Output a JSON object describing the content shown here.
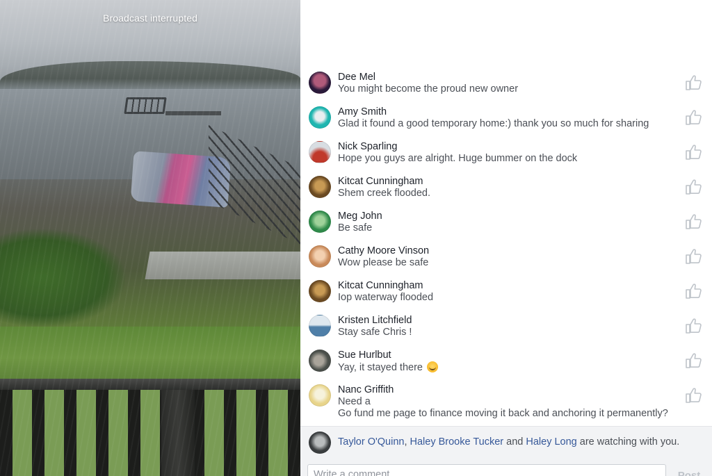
{
  "video": {
    "status_text": "Broadcast interrupted"
  },
  "comments": [
    {
      "author": "Dee Mel",
      "text": "You might become the proud new owner",
      "avatar_colors": [
        "#2a1a3a",
        "#b05a7a"
      ]
    },
    {
      "author": "Amy Smith",
      "text": "Glad it found a good temporary home:) thank you so much for sharing",
      "avatar_colors": [
        "#1fb6b0",
        "#e8eef0"
      ]
    },
    {
      "author": "Nick Sparling",
      "text": "Hope you guys are alright. Huge bummer on the dock",
      "avatar_colors": [
        "#d8dde2",
        "#c0392b"
      ]
    },
    {
      "author": "Kitcat Cunningham",
      "text": "Shem creek flooded.",
      "avatar_colors": [
        "#6b4a22",
        "#c89a54"
      ]
    },
    {
      "author": "Meg John",
      "text": "Be safe",
      "avatar_colors": [
        "#2f8a4a",
        "#9fd29a"
      ]
    },
    {
      "author": "Cathy Moore Vinson",
      "text": "Wow please be safe",
      "avatar_colors": [
        "#c98a5a",
        "#f3d0b0"
      ]
    },
    {
      "author": "Kitcat Cunningham",
      "text": "Iop waterway flooded",
      "avatar_colors": [
        "#6b4a22",
        "#c89a54"
      ]
    },
    {
      "author": "Kristen Litchfield",
      "text": "Stay safe Chris !",
      "avatar_colors": [
        "#4f7fa8",
        "#dfe8ef"
      ]
    },
    {
      "author": "Sue Hurlbut",
      "text": "Yay, it stayed there",
      "emoji": "grinning-face",
      "avatar_colors": [
        "#4a4f4a",
        "#a9a49a"
      ]
    },
    {
      "author": "Nanc Griffith",
      "text_lines": [
        "Need a",
        "Go fund me page to finance moving it back and anchoring it permanently?"
      ],
      "avatar_colors": [
        "#e8d48a",
        "#f6f2dc"
      ]
    }
  ],
  "watching": {
    "viewer_1": "Taylor O'Quinn",
    "separator_1": ",",
    "viewer_2": "Haley Brooke Tucker",
    "conjunction": "and",
    "viewer_3": "Haley Long",
    "suffix": "are watching with you.",
    "avatar_colors": [
      "#3a3d3f",
      "#b9bcbd"
    ]
  },
  "composer": {
    "placeholder": "Write a comment...",
    "post_label": "Post"
  },
  "icons": {
    "like": "thumbs-up-icon"
  },
  "colors": {
    "link": "#365899",
    "author": "#1d2129",
    "comment_text": "#4b4f56",
    "like_icon": "#bec3c9"
  }
}
